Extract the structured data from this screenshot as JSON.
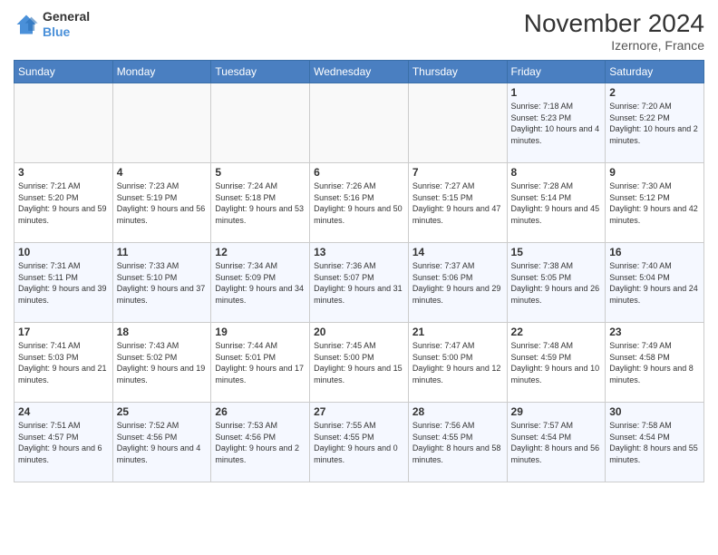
{
  "logo": {
    "line1": "General",
    "line2": "Blue"
  },
  "title": "November 2024",
  "location": "Izernore, France",
  "days_of_week": [
    "Sunday",
    "Monday",
    "Tuesday",
    "Wednesday",
    "Thursday",
    "Friday",
    "Saturday"
  ],
  "weeks": [
    [
      {
        "day": "",
        "info": ""
      },
      {
        "day": "",
        "info": ""
      },
      {
        "day": "",
        "info": ""
      },
      {
        "day": "",
        "info": ""
      },
      {
        "day": "",
        "info": ""
      },
      {
        "day": "1",
        "info": "Sunrise: 7:18 AM\nSunset: 5:23 PM\nDaylight: 10 hours and 4 minutes."
      },
      {
        "day": "2",
        "info": "Sunrise: 7:20 AM\nSunset: 5:22 PM\nDaylight: 10 hours and 2 minutes."
      }
    ],
    [
      {
        "day": "3",
        "info": "Sunrise: 7:21 AM\nSunset: 5:20 PM\nDaylight: 9 hours and 59 minutes."
      },
      {
        "day": "4",
        "info": "Sunrise: 7:23 AM\nSunset: 5:19 PM\nDaylight: 9 hours and 56 minutes."
      },
      {
        "day": "5",
        "info": "Sunrise: 7:24 AM\nSunset: 5:18 PM\nDaylight: 9 hours and 53 minutes."
      },
      {
        "day": "6",
        "info": "Sunrise: 7:26 AM\nSunset: 5:16 PM\nDaylight: 9 hours and 50 minutes."
      },
      {
        "day": "7",
        "info": "Sunrise: 7:27 AM\nSunset: 5:15 PM\nDaylight: 9 hours and 47 minutes."
      },
      {
        "day": "8",
        "info": "Sunrise: 7:28 AM\nSunset: 5:14 PM\nDaylight: 9 hours and 45 minutes."
      },
      {
        "day": "9",
        "info": "Sunrise: 7:30 AM\nSunset: 5:12 PM\nDaylight: 9 hours and 42 minutes."
      }
    ],
    [
      {
        "day": "10",
        "info": "Sunrise: 7:31 AM\nSunset: 5:11 PM\nDaylight: 9 hours and 39 minutes."
      },
      {
        "day": "11",
        "info": "Sunrise: 7:33 AM\nSunset: 5:10 PM\nDaylight: 9 hours and 37 minutes."
      },
      {
        "day": "12",
        "info": "Sunrise: 7:34 AM\nSunset: 5:09 PM\nDaylight: 9 hours and 34 minutes."
      },
      {
        "day": "13",
        "info": "Sunrise: 7:36 AM\nSunset: 5:07 PM\nDaylight: 9 hours and 31 minutes."
      },
      {
        "day": "14",
        "info": "Sunrise: 7:37 AM\nSunset: 5:06 PM\nDaylight: 9 hours and 29 minutes."
      },
      {
        "day": "15",
        "info": "Sunrise: 7:38 AM\nSunset: 5:05 PM\nDaylight: 9 hours and 26 minutes."
      },
      {
        "day": "16",
        "info": "Sunrise: 7:40 AM\nSunset: 5:04 PM\nDaylight: 9 hours and 24 minutes."
      }
    ],
    [
      {
        "day": "17",
        "info": "Sunrise: 7:41 AM\nSunset: 5:03 PM\nDaylight: 9 hours and 21 minutes."
      },
      {
        "day": "18",
        "info": "Sunrise: 7:43 AM\nSunset: 5:02 PM\nDaylight: 9 hours and 19 minutes."
      },
      {
        "day": "19",
        "info": "Sunrise: 7:44 AM\nSunset: 5:01 PM\nDaylight: 9 hours and 17 minutes."
      },
      {
        "day": "20",
        "info": "Sunrise: 7:45 AM\nSunset: 5:00 PM\nDaylight: 9 hours and 15 minutes."
      },
      {
        "day": "21",
        "info": "Sunrise: 7:47 AM\nSunset: 5:00 PM\nDaylight: 9 hours and 12 minutes."
      },
      {
        "day": "22",
        "info": "Sunrise: 7:48 AM\nSunset: 4:59 PM\nDaylight: 9 hours and 10 minutes."
      },
      {
        "day": "23",
        "info": "Sunrise: 7:49 AM\nSunset: 4:58 PM\nDaylight: 9 hours and 8 minutes."
      }
    ],
    [
      {
        "day": "24",
        "info": "Sunrise: 7:51 AM\nSunset: 4:57 PM\nDaylight: 9 hours and 6 minutes."
      },
      {
        "day": "25",
        "info": "Sunrise: 7:52 AM\nSunset: 4:56 PM\nDaylight: 9 hours and 4 minutes."
      },
      {
        "day": "26",
        "info": "Sunrise: 7:53 AM\nSunset: 4:56 PM\nDaylight: 9 hours and 2 minutes."
      },
      {
        "day": "27",
        "info": "Sunrise: 7:55 AM\nSunset: 4:55 PM\nDaylight: 9 hours and 0 minutes."
      },
      {
        "day": "28",
        "info": "Sunrise: 7:56 AM\nSunset: 4:55 PM\nDaylight: 8 hours and 58 minutes."
      },
      {
        "day": "29",
        "info": "Sunrise: 7:57 AM\nSunset: 4:54 PM\nDaylight: 8 hours and 56 minutes."
      },
      {
        "day": "30",
        "info": "Sunrise: 7:58 AM\nSunset: 4:54 PM\nDaylight: 8 hours and 55 minutes."
      }
    ]
  ]
}
